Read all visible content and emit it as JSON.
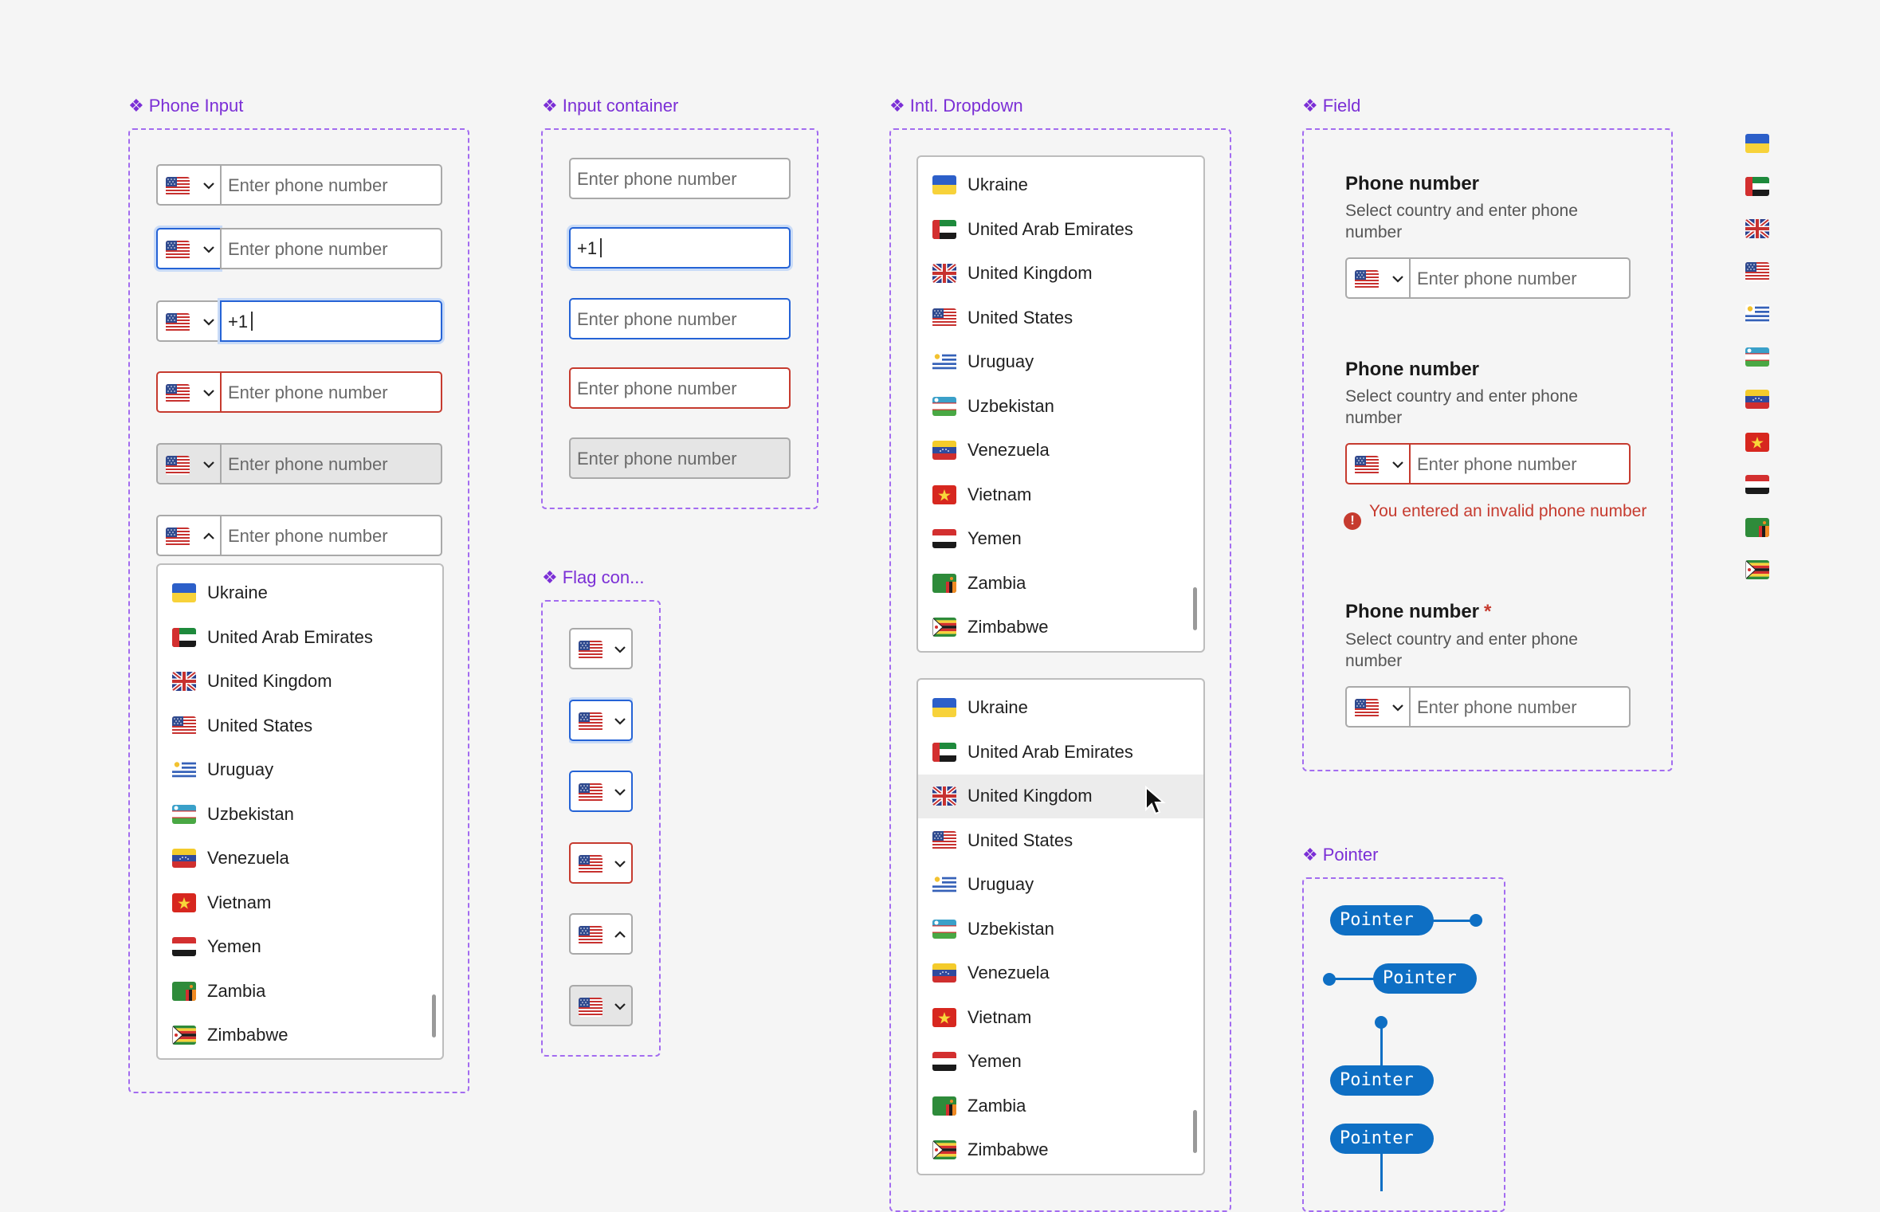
{
  "sections": {
    "phone_input": "Phone Input",
    "input_container": "Input container",
    "intl_dropdown": "Intl. Dropdown",
    "field": "Field",
    "flag_container": "Flag con...",
    "pointer": "Pointer"
  },
  "section_glyph": "❖",
  "placeholder": "Enter phone number",
  "typed_value": "+1",
  "countries": [
    "Ukraine",
    "United Arab Emirates",
    "United Kingdom",
    "United States",
    "Uruguay",
    "Uzbekistan",
    "Venezuela",
    "Vietnam",
    "Yemen",
    "Zambia",
    "Zimbabwe"
  ],
  "hovered_country": "United Kingdom",
  "field": {
    "label": "Phone number",
    "help": "Select country and enter phone number",
    "required_mark": "*",
    "error": "You entered an invalid phone number"
  },
  "pointer_label": "Pointer",
  "colors": {
    "accent_purple": "#7b2fd6",
    "focus_blue": "#2563d6",
    "error_red": "#c63b2f",
    "pointer_blue": "#0e6fc4"
  },
  "icons": [
    "flag-icon",
    "chevron-down-icon",
    "chevron-up-icon",
    "error-icon",
    "cursor-icon"
  ]
}
